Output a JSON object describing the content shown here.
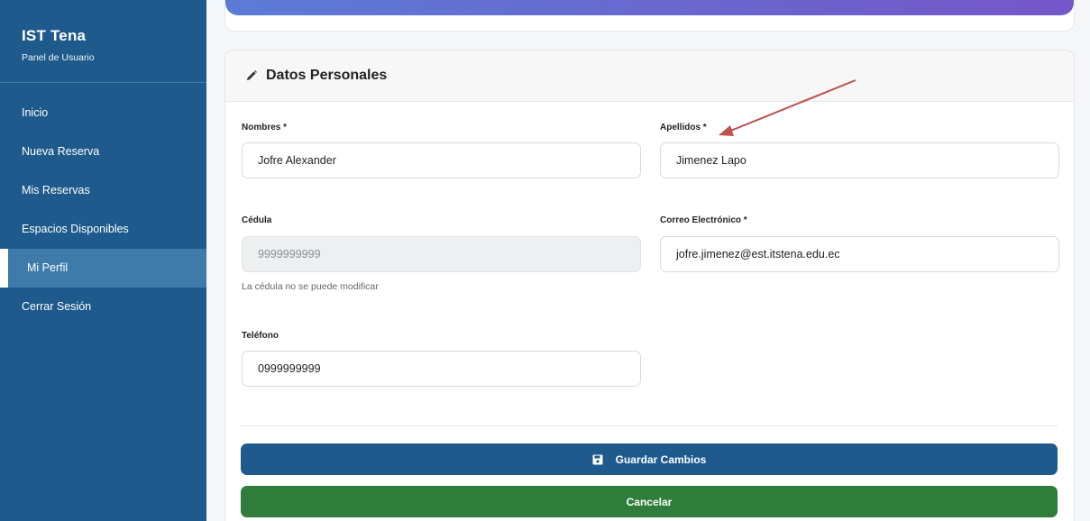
{
  "sidebar": {
    "title": "IST Tena",
    "subtitle": "Panel de Usuario",
    "items": [
      {
        "label": "Inicio"
      },
      {
        "label": "Nueva Reserva"
      },
      {
        "label": "Mis Reservas"
      },
      {
        "label": "Espacios Disponibles"
      },
      {
        "label": "Mi Perfil",
        "active": true
      },
      {
        "label": "Cerrar Sesión"
      }
    ]
  },
  "profile": {
    "section_title": "Datos Personales",
    "section_icon": "pencil-icon",
    "nombres": {
      "label": "Nombres *",
      "value": "Jofre Alexander"
    },
    "apellidos": {
      "label": "Apellidos *",
      "value": "Jimenez Lapo"
    },
    "cedula": {
      "label": "Cédula",
      "value": "9999999999",
      "hint": "La cédula no se puede modificar"
    },
    "correo": {
      "label": "Correo Electrónico *",
      "value": "jofre.jimenez@est.itstena.edu.ec"
    },
    "telefono": {
      "label": "Teléfono",
      "value": "0999999999"
    }
  },
  "actions": {
    "save_label": "Guardar Cambios",
    "save_icon": "save-icon",
    "cancel_label": "Cancelar"
  },
  "colors": {
    "sidebar_bg": "#1e5a8c",
    "save_button": "#1e5a8c",
    "cancel_button": "#2f7d3b",
    "annotation_arrow": "#c0504d"
  }
}
